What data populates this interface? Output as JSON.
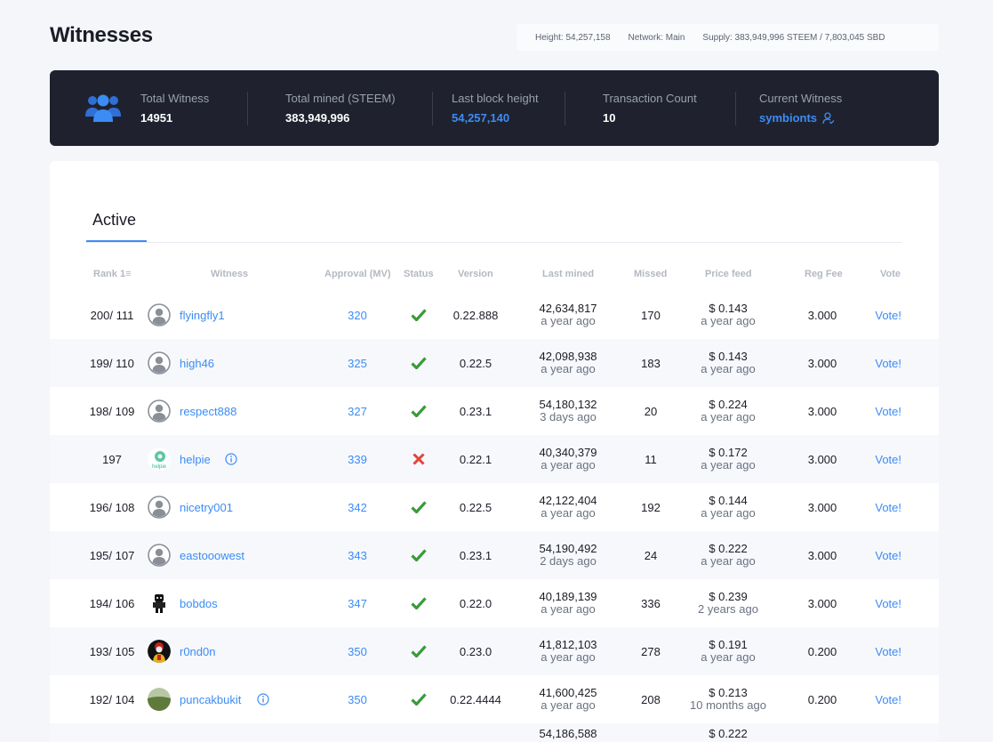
{
  "page": {
    "title": "Witnesses"
  },
  "infobar": {
    "height": "Height: 54,257,158",
    "network": "Network: Main",
    "supply": "Supply: 383,949,996 STEEM / 7,803,045 SBD"
  },
  "stats": {
    "total_witness_label": "Total Witness",
    "total_witness": "14951",
    "total_mined_label": "Total mined (STEEM)",
    "total_mined": "383,949,996",
    "last_block_label": "Last block height",
    "last_block": "54,257,140",
    "tx_count_label": "Transaction Count",
    "tx_count": "10",
    "current_witness_label": "Current Witness",
    "current_witness": "symbionts"
  },
  "tabs": {
    "active": "Active"
  },
  "table": {
    "headers": {
      "rank": "Rank",
      "witness": "Witness",
      "approval": "Approval (MV)",
      "status": "Status",
      "version": "Version",
      "last_mined": "Last mined",
      "missed": "Missed",
      "price_feed": "Price feed",
      "reg_fee": "Reg Fee",
      "vote": "Vote"
    },
    "rows": [
      {
        "rank": "200/ 111",
        "name": "flyingfly1",
        "avatar": "default",
        "info": false,
        "approval": "320",
        "status": "ok",
        "version": "0.22.888",
        "block": "42,634,817",
        "block_ago": "a year ago",
        "missed": "170",
        "price": "$ 0.143",
        "price_ago": "a year ago",
        "fee": "3.000",
        "vote": "Vote!"
      },
      {
        "rank": "199/ 110",
        "name": "high46",
        "avatar": "default",
        "info": false,
        "approval": "325",
        "status": "ok",
        "version": "0.22.5",
        "block": "42,098,938",
        "block_ago": "a year ago",
        "missed": "183",
        "price": "$ 0.143",
        "price_ago": "a year ago",
        "fee": "3.000",
        "vote": "Vote!"
      },
      {
        "rank": "198/ 109",
        "name": "respect888",
        "avatar": "default",
        "info": false,
        "approval": "327",
        "status": "ok",
        "version": "0.23.1",
        "block": "54,180,132",
        "block_ago": "3 days ago",
        "missed": "20",
        "price": "$ 0.224",
        "price_ago": "a year ago",
        "fee": "3.000",
        "vote": "Vote!"
      },
      {
        "rank": "197",
        "name": "helpie",
        "avatar": "helpie",
        "info": true,
        "approval": "339",
        "status": "fail",
        "version": "0.22.1",
        "block": "40,340,379",
        "block_ago": "a year ago",
        "missed": "11",
        "price": "$ 0.172",
        "price_ago": "a year ago",
        "fee": "3.000",
        "vote": "Vote!"
      },
      {
        "rank": "196/ 108",
        "name": "nicetry001",
        "avatar": "default",
        "info": false,
        "approval": "342",
        "status": "ok",
        "version": "0.22.5",
        "block": "42,122,404",
        "block_ago": "a year ago",
        "missed": "192",
        "price": "$ 0.144",
        "price_ago": "a year ago",
        "fee": "3.000",
        "vote": "Vote!"
      },
      {
        "rank": "195/ 107",
        "name": "eastooowest",
        "avatar": "default",
        "info": false,
        "approval": "343",
        "status": "ok",
        "version": "0.23.1",
        "block": "54,190,492",
        "block_ago": "2 days ago",
        "missed": "24",
        "price": "$ 0.222",
        "price_ago": "a year ago",
        "fee": "3.000",
        "vote": "Vote!"
      },
      {
        "rank": "194/ 106",
        "name": "bobdos",
        "avatar": "robot",
        "info": false,
        "approval": "347",
        "status": "ok",
        "version": "0.22.0",
        "block": "40,189,139",
        "block_ago": "a year ago",
        "missed": "336",
        "price": "$ 0.239",
        "price_ago": "2 years ago",
        "fee": "3.000",
        "vote": "Vote!"
      },
      {
        "rank": "193/ 105",
        "name": "r0nd0n",
        "avatar": "clown",
        "info": false,
        "approval": "350",
        "status": "ok",
        "version": "0.23.0",
        "block": "41,812,103",
        "block_ago": "a year ago",
        "missed": "278",
        "price": "$ 0.191",
        "price_ago": "a year ago",
        "fee": "0.200",
        "vote": "Vote!"
      },
      {
        "rank": "192/ 104",
        "name": "puncakbukit",
        "avatar": "landscape",
        "info": true,
        "approval": "350",
        "status": "ok",
        "version": "0.22.4444",
        "block": "41,600,425",
        "block_ago": "a year ago",
        "missed": "208",
        "price": "$ 0.213",
        "price_ago": "10 months ago",
        "fee": "0.200",
        "vote": "Vote!"
      },
      {
        "rank": "",
        "name": "",
        "avatar": "default",
        "info": false,
        "approval": "",
        "status": "",
        "version": "",
        "block": "54,186,588",
        "block_ago": "",
        "missed": "",
        "price": "$ 0.222",
        "price_ago": "",
        "fee": "",
        "vote": ""
      }
    ]
  },
  "colors": {
    "accent": "#3c8cf5",
    "banner": "#1f222e",
    "ok": "#3a9a3a",
    "fail": "#e0443c"
  }
}
